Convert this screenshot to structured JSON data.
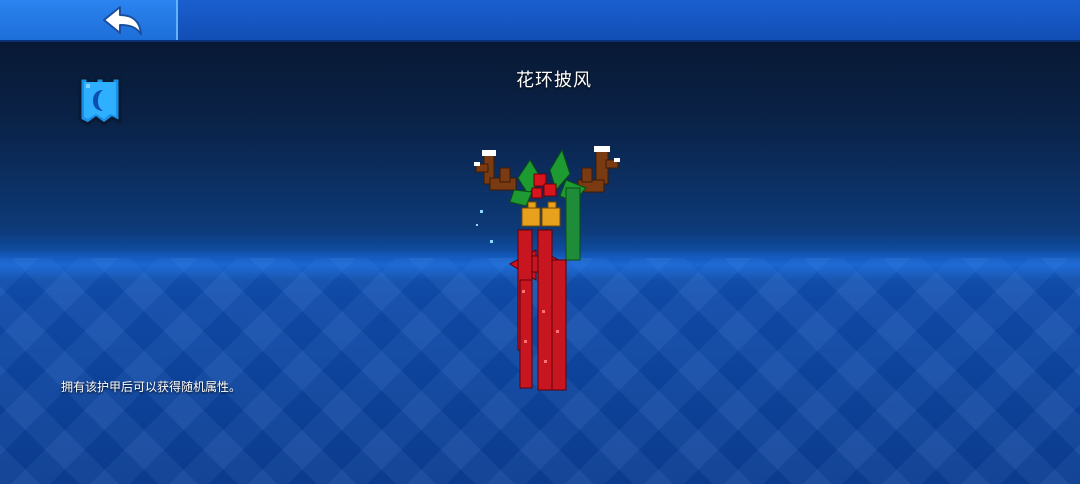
{
  "header": {
    "back_icon": "back-arrow-icon"
  },
  "item": {
    "name": "花环披风",
    "description": "拥有该护甲后可以获得随机属性。",
    "category_icon": "cape-category-icon",
    "preview": "wreath-cape-model"
  },
  "colors": {
    "topbar": "#124eb5",
    "back_button": "#1d6ed8",
    "background_top": "#07142a",
    "floor": "#0f4cae"
  }
}
